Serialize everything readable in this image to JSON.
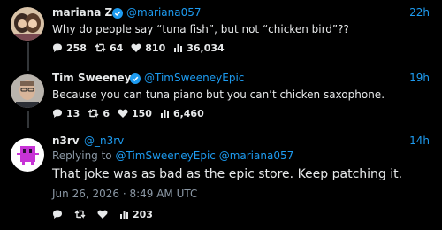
{
  "tweets": [
    {
      "name": "mariana Z",
      "handle": "@mariana057",
      "time": "22h",
      "text": "Why do people say “tuna fish”, but not “chicken bird”??",
      "stats": {
        "replies": "258",
        "retweets": "64",
        "likes": "810",
        "views": "36,034"
      }
    },
    {
      "name": "Tim Sweeney",
      "handle": "@TimSweeneyEpic",
      "time": "19h",
      "text": "Because you can tuna piano but you can’t chicken saxophone.",
      "stats": {
        "replies": "13",
        "retweets": "6",
        "likes": "150",
        "views": "6,460"
      }
    },
    {
      "name": "n3rv",
      "handle": "@_n3rv",
      "time": "14h",
      "reply_prefix": "Replying to",
      "reply_mentions": "@TimSweeneyEpic @mariana057",
      "text": "That joke was as bad as the epic store. Keep patching it.",
      "date": "Jun 26, 2026 · 8:49 AM UTC",
      "stats": {
        "views": "203"
      }
    }
  ],
  "colors": {
    "accent": "#1d9bf0",
    "background": "#000000",
    "text": "#e7e9ea",
    "muted": "#8b98a5"
  }
}
